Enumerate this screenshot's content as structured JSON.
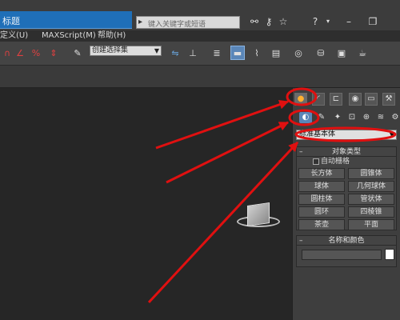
{
  "window": {
    "title_fragment": "标题",
    "search_placeholder": "键入关键字或短语",
    "icons": [
      "binoculars-icon",
      "key-icon",
      "star-icon",
      "help-icon",
      "minimize-icon",
      "restore-icon"
    ]
  },
  "menu": {
    "items": [
      "定义(U)",
      "MAXScript(M)",
      "帮助(H)"
    ]
  },
  "toolbar": {
    "selection_set": "创建选择集",
    "tools": [
      "snap-icon",
      "angle-snap-icon",
      "percent-snap-icon",
      "spinner-snap-icon",
      "edit-named-selection-icon",
      "mirror-icon",
      "align-icon",
      "layers-icon",
      "graphite-icon",
      "curve-editor-icon",
      "schematic-icon",
      "material-editor-icon",
      "render-setup-icon",
      "rendered-frame-icon",
      "render-icon"
    ]
  },
  "command_panel": {
    "tabs": [
      "create-tab-icon",
      "modify-tab-icon",
      "hierarchy-tab-icon",
      "motion-tab-icon",
      "display-tab-icon",
      "utilities-tab-icon"
    ],
    "subcategories": [
      "geometry-icon",
      "shapes-icon",
      "lights-icon",
      "cameras-icon",
      "helpers-icon",
      "space-warps-icon",
      "systems-icon"
    ],
    "category": "标准基本体",
    "object_type": {
      "header": "对象类型",
      "autogrid": "自动栅格",
      "buttons": [
        "长方体",
        "圆锥体",
        "球体",
        "几何球体",
        "圆柱体",
        "管状体",
        "圆环",
        "四棱锥",
        "茶壶",
        "平面"
      ]
    },
    "name_color": {
      "header": "名称和颜色",
      "name_value": "",
      "color": "#ffffff"
    }
  },
  "annotation_color": "#e01010"
}
